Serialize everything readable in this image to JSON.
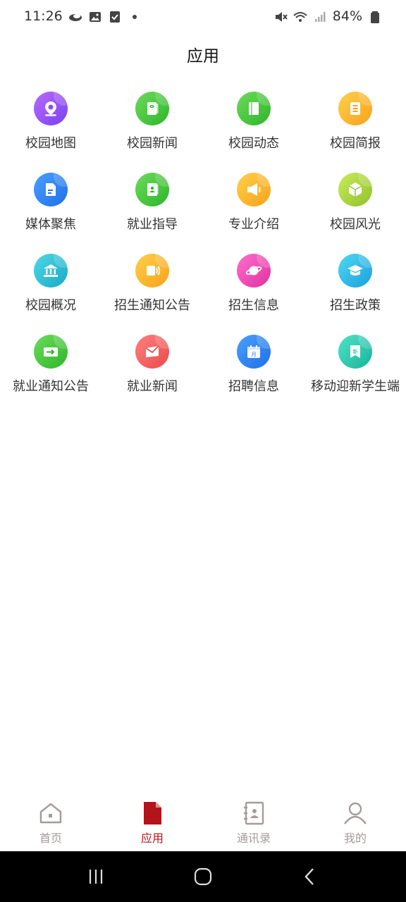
{
  "status_bar": {
    "time": "11:26",
    "battery": "84%",
    "icons": [
      "cloud-icon",
      "image-icon",
      "checkbox-icon",
      "dot-icon",
      "mute-icon",
      "wifi-icon",
      "signal-icon",
      "battery-icon"
    ]
  },
  "header": {
    "title": "应用"
  },
  "apps": [
    {
      "label": "校园地图",
      "icon": "map-pin-icon",
      "color1": "#b86bff",
      "color2": "#7a3ff0"
    },
    {
      "label": "校园新闻",
      "icon": "news-book-icon",
      "color1": "#6edb5c",
      "color2": "#2db52a"
    },
    {
      "label": "校园动态",
      "icon": "book-icon",
      "color1": "#6edb5c",
      "color2": "#2db52a"
    },
    {
      "label": "校园简报",
      "icon": "list-doc-icon",
      "color1": "#ffd04a",
      "color2": "#f7a21b"
    },
    {
      "label": "媒体聚焦",
      "icon": "document-icon",
      "color1": "#4aa0ff",
      "color2": "#1f6fe8"
    },
    {
      "label": "就业指导",
      "icon": "contact-card-icon",
      "color1": "#6edb5c",
      "color2": "#2db52a"
    },
    {
      "label": "专业介绍",
      "icon": "megaphone-icon",
      "color1": "#ffd04a",
      "color2": "#f7a21b"
    },
    {
      "label": "校园风光",
      "icon": "cube-icon",
      "color1": "#c8ec5a",
      "color2": "#8fc22a"
    },
    {
      "label": "校园概况",
      "icon": "building-icon",
      "color1": "#4fd9e8",
      "color2": "#17a9c4"
    },
    {
      "label": "招生通知公告",
      "icon": "speaker-icon",
      "color1": "#ffd04a",
      "color2": "#f7a21b"
    },
    {
      "label": "招生信息",
      "icon": "planet-icon",
      "color1": "#ff6fcf",
      "color2": "#e0309f"
    },
    {
      "label": "招生政策",
      "icon": "graduation-cap-icon",
      "color1": "#4fd9f0",
      "color2": "#1a9fe0"
    },
    {
      "label": "就业通知公告",
      "icon": "arrow-card-icon",
      "color1": "#6edb5c",
      "color2": "#2db52a"
    },
    {
      "label": "就业新闻",
      "icon": "mail-icon",
      "color1": "#ff8080",
      "color2": "#ea4a4a"
    },
    {
      "label": "招聘信息",
      "icon": "calendar-icon",
      "color1": "#4aa0ff",
      "color2": "#1f6fe8"
    },
    {
      "label": "移动迎新学生端",
      "icon": "new-badge-icon",
      "color1": "#4fe3c8",
      "color2": "#18b49a",
      "badge_text": "新"
    }
  ],
  "tabs": [
    {
      "label": "首页",
      "icon": "home-icon",
      "active": false
    },
    {
      "label": "应用",
      "icon": "file-icon",
      "active": true
    },
    {
      "label": "通讯录",
      "icon": "address-book-icon",
      "active": false
    },
    {
      "label": "我的",
      "icon": "user-icon",
      "active": false
    }
  ],
  "colors": {
    "accent": "#b3131b",
    "tab_inactive": "#a69a9a"
  },
  "system_nav": [
    "recent-apps-icon",
    "home-circle-icon",
    "back-icon"
  ]
}
